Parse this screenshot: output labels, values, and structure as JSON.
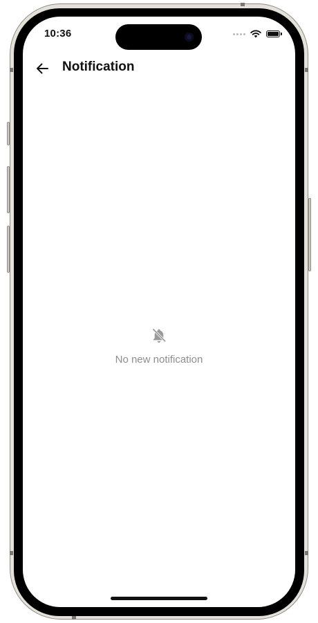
{
  "status_bar": {
    "time": "10:36"
  },
  "app_bar": {
    "title": "Notification",
    "back_icon": "arrow-left-icon"
  },
  "empty_state": {
    "icon": "bell-off-icon",
    "message": "No new notification"
  },
  "colors": {
    "background": "#ffffff",
    "title_text": "#111111",
    "muted_text": "#8d8d8d",
    "muted_icon": "#9a9a9a"
  }
}
